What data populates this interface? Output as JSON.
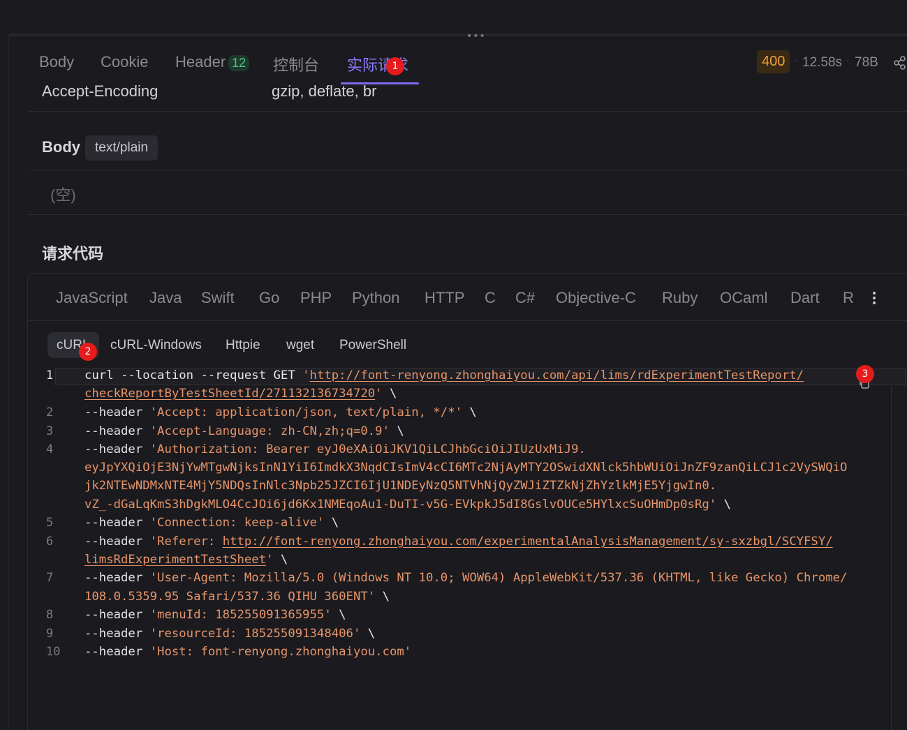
{
  "tabs": [
    {
      "label": "Body"
    },
    {
      "label": "Cookie"
    },
    {
      "label": "Header",
      "count": "12"
    },
    {
      "label": "控制台"
    },
    {
      "label": "实际请求"
    }
  ],
  "status": {
    "code": "400",
    "time": "12.58s",
    "size": "78B",
    "sep": "·"
  },
  "header_row": {
    "key": "Accept-Encoding",
    "value": "gzip, deflate, br"
  },
  "body": {
    "title": "Body",
    "type": "text/plain",
    "empty": "(空)"
  },
  "code_section": {
    "title": "请求代码"
  },
  "languages": [
    "JavaScript",
    "Java",
    "Swift",
    "Go",
    "PHP",
    "Python",
    "HTTP",
    "C",
    "C#",
    "Objective-C",
    "Ruby",
    "OCaml",
    "Dart",
    "R"
  ],
  "variants": [
    "cURL",
    "cURL-Windows",
    "Httpie",
    "wget",
    "PowerShell"
  ],
  "markers": [
    "1",
    "2",
    "3"
  ],
  "code": {
    "line_numbers": [
      "1",
      "2",
      "3",
      "4",
      "5",
      "6",
      "7",
      "8",
      "9",
      "10"
    ],
    "l1a": "curl --location --request GET ",
    "l1q": "'",
    "l1url": "http://font-renyong.zhonghaiyou.com/api/lims/rdExperimentTestReport/",
    "l1b_url": "checkReportByTestSheetId/271132136734720",
    "l1b_end": "' \\",
    "l2a": "--header ",
    "l2s": "'Accept: application/json, text/plain, */*'",
    "l2e": " \\",
    "l3a": "--header ",
    "l3s": "'Accept-Language: zh-CN,zh;q=0.9'",
    "l3e": " \\",
    "l4a": "--header ",
    "l4s": "'Authorization: Bearer eyJ0eXAiOiJKV1QiLCJhbGciOiJIUzUxMiJ9.",
    "l4b": "eyJpYXQiOjE3NjYwMTgwNjksInN1YiI6ImdkX3NqdCIsImV4cCI6MTc2NjAyMTY2OSwidXNlck5hbWUiOiJnZF9zanQiLCJ1c2VySWQiO",
    "l4c": "jk2NTEwNDMxNTE4MjY5NDQsInNlc3Npb25JZCI6IjU1NDEyNzQ5NTVhNjQyZWJiZTZkNjZhYzlkMjE5YjgwIn0.",
    "l4d": "vZ_-dGaLqKmS3hDgkMLO4CcJOi6jd6Kx1NMEqoAu1-DuTI-v5G-EVkpkJ5dI8GslvOUCe5HYlxcSuOHmDp0sRg'",
    "l4e": " \\",
    "l5a": "--header ",
    "l5s": "'Connection: keep-alive'",
    "l5e": " \\",
    "l6a": "--header ",
    "l6s": "'Referer: ",
    "l6url": "http://font-renyong.zhonghaiyou.com/experimentalAnalysisManagement/sy-sxzbgl/SCYFSY/",
    "l6b_url": "limsRdExperimentTestSheet",
    "l6b_end": "'",
    "l6e": " \\",
    "l7a": "--header ",
    "l7s": "'User-Agent: Mozilla/5.0 (Windows NT 10.0; WOW64) AppleWebKit/537.36 (KHTML, like Gecko) Chrome/",
    "l7b": "108.0.5359.95 Safari/537.36 QIHU 360ENT'",
    "l7e": " \\",
    "l8a": "--header ",
    "l8s": "'menuId: 185255091365955'",
    "l8e": " \\",
    "l9a": "--header ",
    "l9s": "'resourceId: 185255091348406'",
    "l9e": " \\",
    "l10a": "--header ",
    "l10s": "'Host: font-renyong.zhonghaiyou.com'"
  },
  "colors": {
    "accent": "#8b7bff",
    "status_warn": "#f0a33a",
    "string": "#e6946a",
    "count_green": "#4cc38a"
  },
  "icons": {
    "share": "share-icon",
    "more": "more-vertical-icon",
    "copy": "copy-icon",
    "drag": "drag-handle-icon"
  }
}
